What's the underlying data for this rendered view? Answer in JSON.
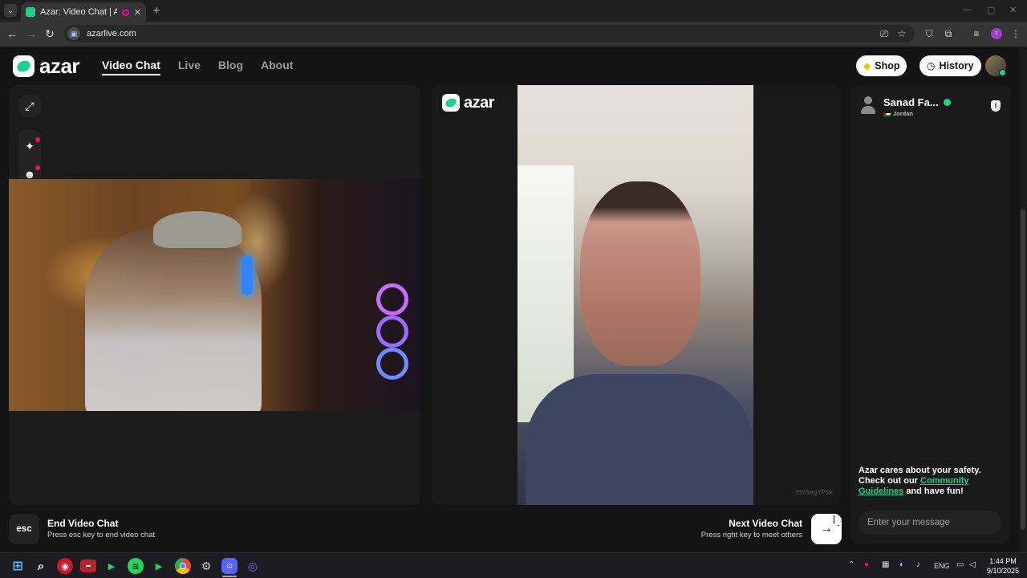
{
  "browser": {
    "tab_title": "Azar: Video Chat | Alternati",
    "tab_menu_icon": "chevron-down-icon",
    "new_tab_icon": "plus-icon",
    "close_tab_glyph": "✕",
    "url": "azarlive.com",
    "url_icon": "site-info-icon",
    "profile_initial": "t",
    "toolbar_icons": [
      "install-app-icon",
      "bookmark-star-icon",
      "shield-extension-icon",
      "extensions-puzzle-icon",
      "media-controls-icon",
      "profile-icon",
      "kebab-menu-icon"
    ]
  },
  "header": {
    "logo_text": "azar",
    "nav": {
      "video_chat": "Video Chat",
      "live": "Live",
      "blog": "Blog",
      "about": "About"
    },
    "shop_label": "Shop",
    "history_label": "History"
  },
  "left_pane": {
    "tools": [
      "expand-icon",
      "effects-sparkle-icon",
      "face-filter-icon"
    ]
  },
  "mid_pane": {
    "logo_text": "azar",
    "session_code": "J5S5egYP5k"
  },
  "right_pane": {
    "peer_name": "Sanad Fa...",
    "peer_country": "Jordan",
    "safety_line1": "Azar cares about your safety.",
    "safety_line2": "Check out our",
    "safety_link": "Community Guidelines",
    "safety_line3": "and have fun!",
    "message_placeholder": "Enter your message"
  },
  "footer": {
    "esc_key": "esc",
    "end_title": "End Video Chat",
    "end_sub": "Press esc key to end video chat",
    "next_title": "Next Video Chat",
    "next_sub": "Press right key to meet others",
    "next_arrow": "→"
  },
  "taskbar": {
    "apps": [
      "windows-start-icon",
      "search-icon",
      "app-red-icon",
      "app-thumbnail-icon",
      "app-green-play-icon",
      "spotify-icon",
      "app-green-play-2-icon",
      "chrome-icon",
      "settings-icon",
      "discord-icon",
      "app-ring-icon"
    ],
    "language": "ENG",
    "time": "1:44 PM",
    "date": "9/10/2025"
  }
}
